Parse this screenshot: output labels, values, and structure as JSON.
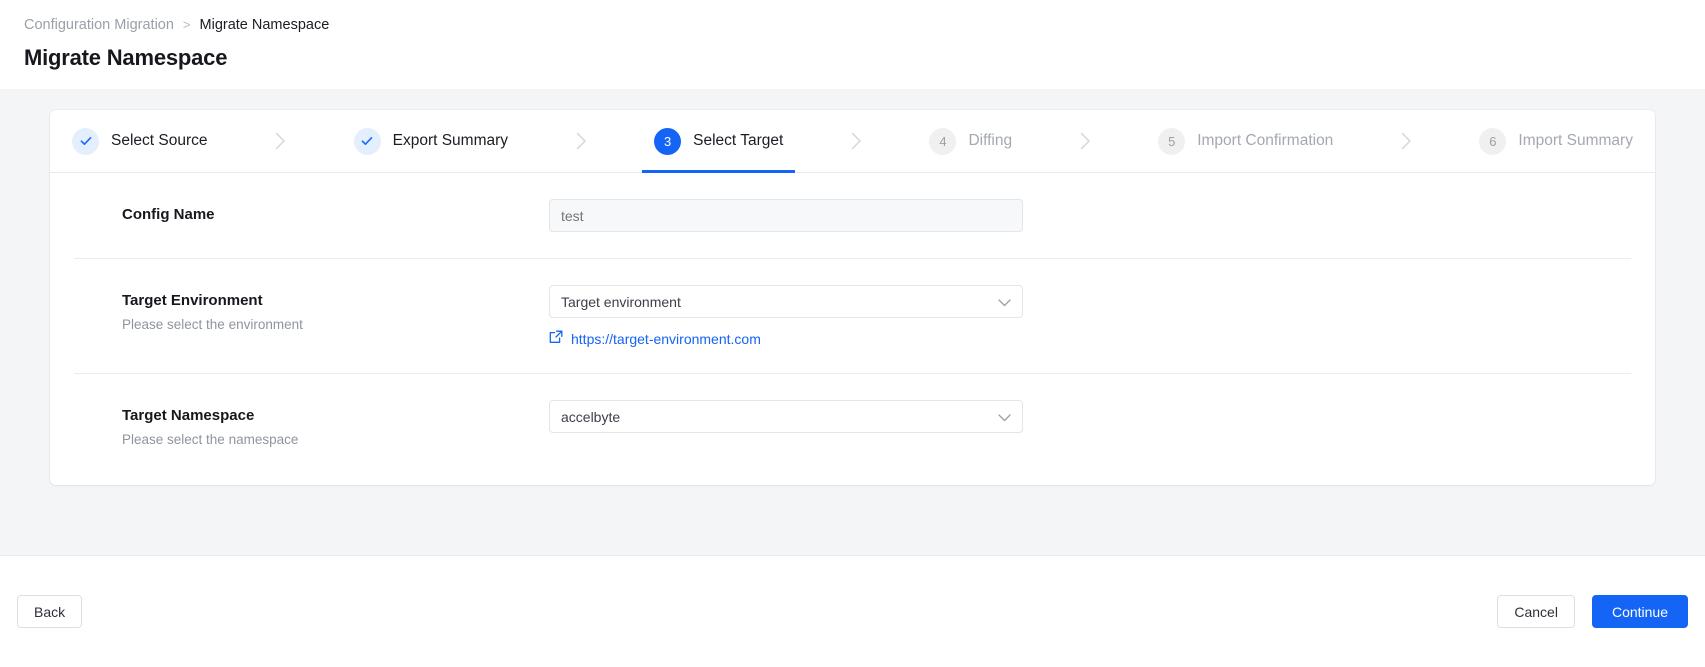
{
  "header": {
    "breadcrumb": {
      "parent": "Configuration Migration",
      "separator": ">",
      "current": "Migrate Namespace"
    },
    "title": "Migrate Namespace"
  },
  "stepper": {
    "steps": [
      {
        "number": "1",
        "label": "Select Source",
        "state": "done",
        "icon": "check-icon"
      },
      {
        "number": "2",
        "label": "Export Summary",
        "state": "done",
        "icon": "check-icon"
      },
      {
        "number": "3",
        "label": "Select Target",
        "state": "active",
        "icon": ""
      },
      {
        "number": "4",
        "label": "Diffing",
        "state": "todo",
        "icon": ""
      },
      {
        "number": "5",
        "label": "Import Confirmation",
        "state": "todo",
        "icon": ""
      },
      {
        "number": "6",
        "label": "Import Summary",
        "state": "todo",
        "icon": ""
      }
    ],
    "separator_icon": "chevron-right-icon"
  },
  "form": {
    "config_name": {
      "label": "Config Name",
      "value": "test",
      "placeholder": "test"
    },
    "target_environment": {
      "label": "Target Environment",
      "description": "Please select the environment",
      "value": "Target environment",
      "caret_icon": "chevron-down-icon",
      "link": {
        "text": "https://target-environment.com",
        "icon": "external-link-icon"
      }
    },
    "target_namespace": {
      "label": "Target Namespace",
      "description": "Please select the namespace",
      "value": "accelbyte",
      "caret_icon": "chevron-down-icon"
    }
  },
  "footer": {
    "back_label": "Back",
    "cancel_label": "Cancel",
    "continue_label": "Continue"
  },
  "colors": {
    "accent": "#1464f5",
    "accent_soft": "#e4effd",
    "page_bg": "#f4f5f7",
    "muted_text": "#9aa0a9"
  }
}
